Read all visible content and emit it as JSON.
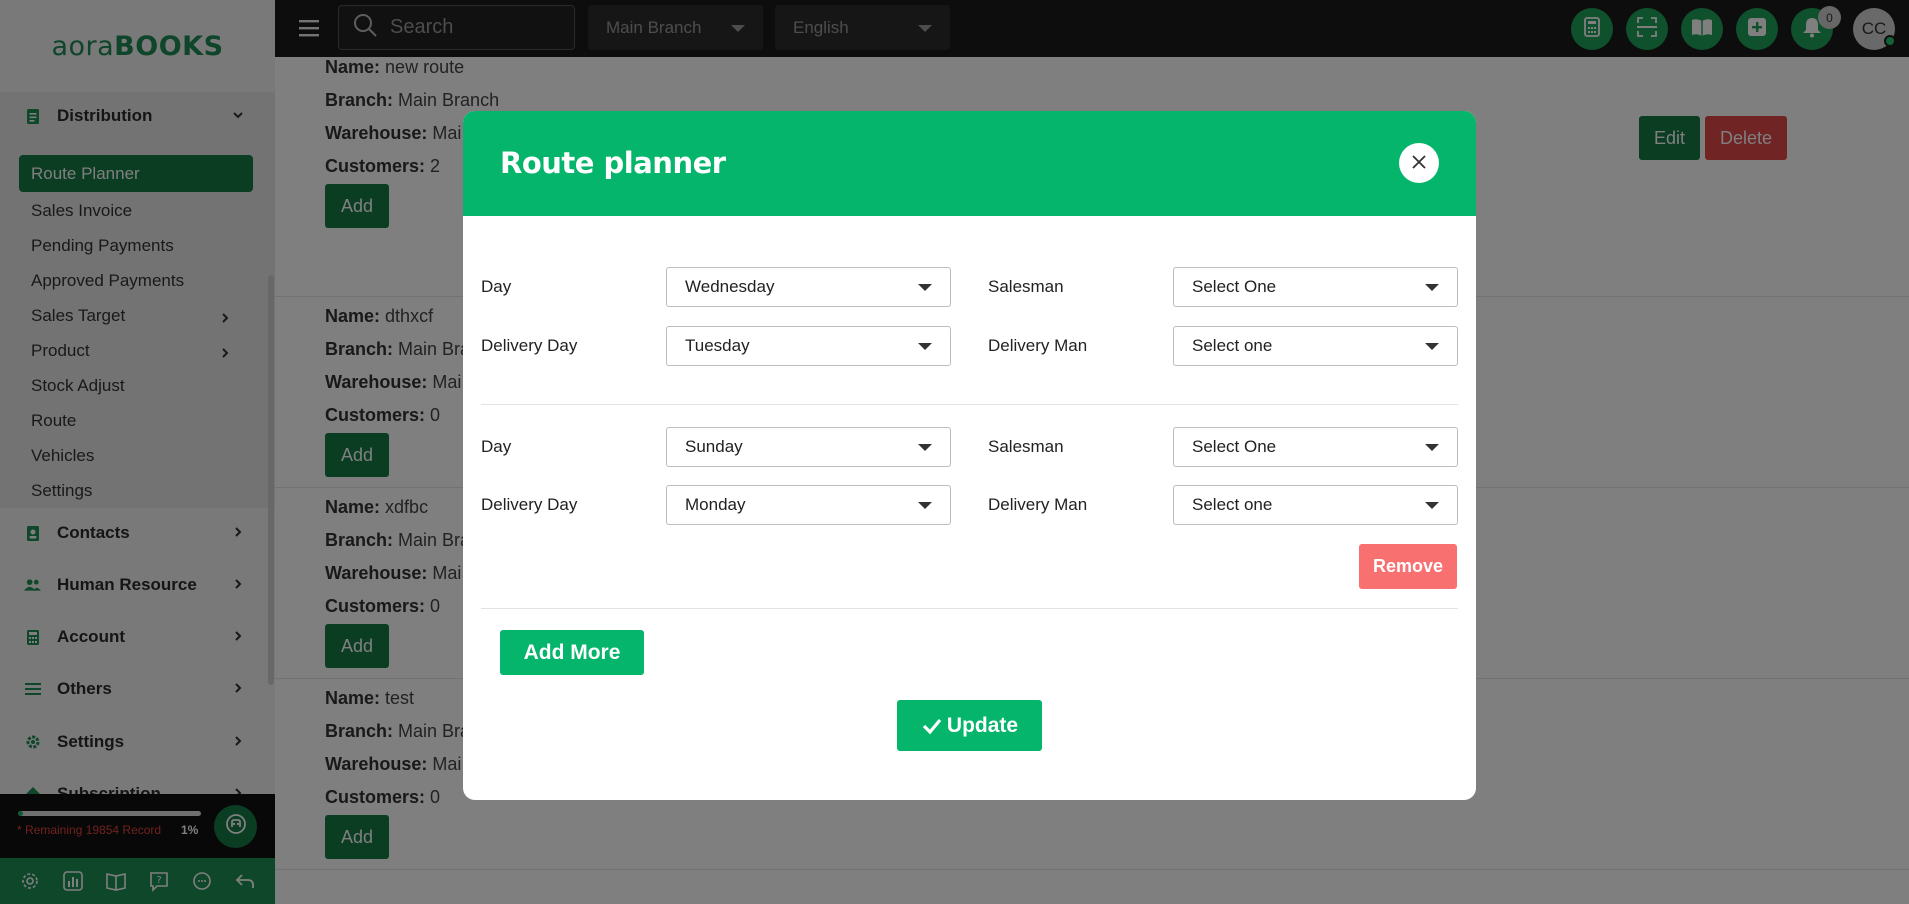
{
  "app": {
    "logo_part1": "aora",
    "logo_part2": "BOOKS"
  },
  "topbar": {
    "search_placeholder": "Search",
    "branch": "Main Branch",
    "language": "English",
    "notification_count": "0",
    "avatar_initials": "CC",
    "icons": [
      "calculator-icon",
      "scan-icon",
      "book-icon",
      "plus-square-icon",
      "bell-icon"
    ]
  },
  "sidebar": {
    "distribution": {
      "label": "Distribution",
      "items": [
        {
          "label": "Route Planner",
          "active": true
        },
        {
          "label": "Sales Invoice"
        },
        {
          "label": "Pending Payments"
        },
        {
          "label": "Approved Payments"
        },
        {
          "label": "Sales Target",
          "has_children": true
        },
        {
          "label": "Product",
          "has_children": true
        },
        {
          "label": "Stock Adjust"
        },
        {
          "label": "Route"
        },
        {
          "label": "Vehicles"
        },
        {
          "label": "Settings"
        }
      ]
    },
    "sections": [
      {
        "label": "Contacts"
      },
      {
        "label": "Human Resource"
      },
      {
        "label": "Account"
      },
      {
        "label": "Others"
      },
      {
        "label": "Settings"
      },
      {
        "label": "Subscription"
      }
    ],
    "usage": {
      "remaining_text": "* Remaining 19854 Record",
      "percent_text": "1%",
      "percent": 0.01
    },
    "bottom_icons": [
      "settings-icon",
      "chart-icon",
      "book-icon",
      "help-icon",
      "chat-icon",
      "back-icon"
    ]
  },
  "routes": [
    {
      "name_label": "Name:",
      "name": "new route",
      "branch_label": "Branch:",
      "branch": "Main Branch",
      "warehouse_label": "Warehouse:",
      "warehouse": "Mai",
      "customers_label": "Customers:",
      "customers": "2",
      "add_label": "Add"
    },
    {
      "name_label": "Name:",
      "name": "dthxcf",
      "branch_label": "Branch:",
      "branch": "Main Bra",
      "warehouse_label": "Warehouse:",
      "warehouse": "Mai",
      "customers_label": "Customers:",
      "customers": "0",
      "add_label": "Add"
    },
    {
      "name_label": "Name:",
      "name": "xdfbc",
      "branch_label": "Branch:",
      "branch": "Main Bra",
      "warehouse_label": "Warehouse:",
      "warehouse": "Mai",
      "customers_label": "Customers:",
      "customers": "0",
      "add_label": "Add"
    },
    {
      "name_label": "Name:",
      "name": "test",
      "branch_label": "Branch:",
      "branch": "Main Bra",
      "warehouse_label": "Warehouse:",
      "warehouse": "Mai",
      "customers_label": "Customers:",
      "customers": "0",
      "add_label": "Add"
    }
  ],
  "route_actions": {
    "edit": "Edit",
    "delete": "Delete"
  },
  "modal": {
    "title": "Route planner",
    "rows": [
      {
        "day_label": "Day",
        "day": "Wednesday",
        "salesman_label": "Salesman",
        "salesman": "Select One",
        "delivery_day_label": "Delivery Day",
        "delivery_day": "Tuesday",
        "delivery_man_label": "Delivery Man",
        "delivery_man": "Select one"
      },
      {
        "day_label": "Day",
        "day": "Sunday",
        "salesman_label": "Salesman",
        "salesman": "Select One",
        "delivery_day_label": "Delivery Day",
        "delivery_day": "Monday",
        "delivery_man_label": "Delivery Man",
        "delivery_man": "Select one"
      }
    ],
    "remove_label": "Remove",
    "add_more_label": "Add More",
    "update_label": "Update"
  },
  "colors": {
    "brand_green": "#05b56b",
    "dark_green": "#157a45",
    "danger": "#e04848",
    "remove": "#f87070",
    "topbar": "#1a1a1a"
  }
}
